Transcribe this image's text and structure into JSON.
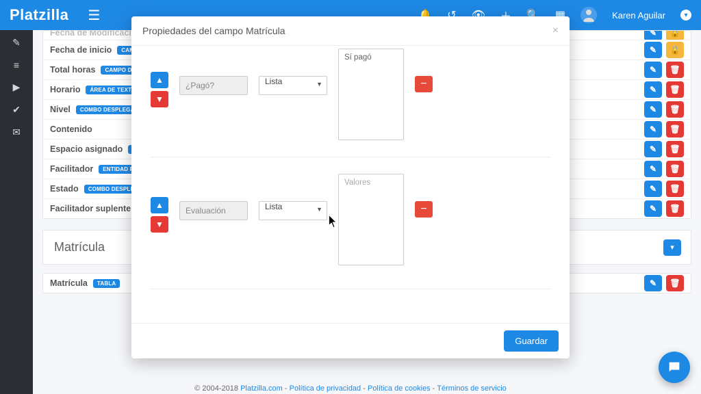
{
  "brand": "Platzilla",
  "user": {
    "name": "Karen Aguilar"
  },
  "modal": {
    "title": "Propiedades del campo Matrícula",
    "save_label": "Guardar",
    "rows": [
      {
        "name": "¿Pagó?",
        "type": "Lista",
        "values": "Sí pagó",
        "placeholder": "Valores"
      },
      {
        "name": "Evaluación",
        "type": "Lista",
        "values": "",
        "placeholder": "Valores"
      }
    ]
  },
  "fields": [
    {
      "label": "Fecha de Modificación",
      "tag": "",
      "actions": [
        "edit",
        "lock"
      ]
    },
    {
      "label": "Fecha de inicio",
      "tag": "CAMPO",
      "actions": [
        "edit",
        "lock"
      ]
    },
    {
      "label": "Total horas",
      "tag": "CAMPO DE T",
      "actions": [
        "edit",
        "del"
      ]
    },
    {
      "label": "Horario",
      "tag": "ÁREA DE TEXTO",
      "actions": [
        "edit",
        "del"
      ]
    },
    {
      "label": "Nivel",
      "tag": "COMBO DESPLEGABLE",
      "actions": [
        "edit",
        "del"
      ]
    },
    {
      "label": "Contenido",
      "tag": "",
      "actions": [
        "edit",
        "del"
      ]
    },
    {
      "label": "Espacio asignado",
      "tag": "CO",
      "actions": [
        "edit",
        "del"
      ]
    },
    {
      "label": "Facilitador",
      "tag": "ENTIDAD RELACIONADA",
      "actions": [
        "edit",
        "del"
      ]
    },
    {
      "label": "Estado",
      "tag": "COMBO DESPLEGABLE",
      "actions": [
        "edit",
        "del"
      ]
    },
    {
      "label": "Facilitador suplente",
      "tag": "",
      "actions": [
        "edit",
        "del"
      ]
    }
  ],
  "section2": {
    "title": "Matrícula"
  },
  "section2_fields": [
    {
      "label": "Matrícula",
      "tag": "TABLA",
      "actions": [
        "edit",
        "del"
      ]
    }
  ],
  "footer": {
    "copyright": "© 2004-2018 ",
    "site": "Platzilla.com",
    "sep": " - ",
    "privacy": "Política de privacidad",
    "cookies": "Política de cookies",
    "terms": "Términos de servicio"
  }
}
